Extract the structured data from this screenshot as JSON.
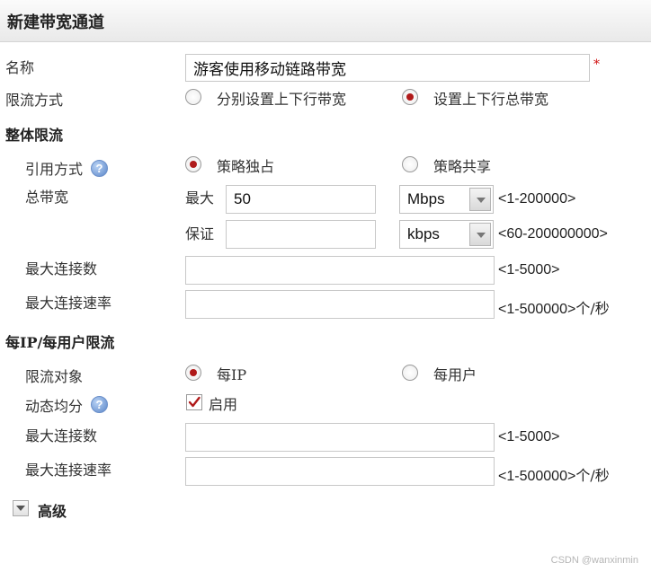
{
  "dialog": {
    "title": "新建带宽通道"
  },
  "name_field": {
    "label": "名称",
    "value": "游客使用移动链路带宽",
    "required_mark": "*"
  },
  "limit_mode": {
    "label": "限流方式",
    "options": [
      {
        "label": "分别设置上下行带宽",
        "selected": false
      },
      {
        "label": "设置上下行总带宽",
        "selected": true
      }
    ]
  },
  "overall": {
    "section_title": "整体限流",
    "reference": {
      "label": "引用方式",
      "options": [
        {
          "label": "策略独占",
          "selected": true
        },
        {
          "label": "策略共享",
          "selected": false
        }
      ]
    },
    "total_bandwidth": {
      "label": "总带宽",
      "max": {
        "label": "最大",
        "value": "50",
        "unit": "Mbps",
        "range": "<1-200000>"
      },
      "guarantee": {
        "label": "保证",
        "value": "",
        "unit": "kbps",
        "range": "<60-200000000>"
      }
    },
    "max_connections": {
      "label": "最大连接数",
      "value": "",
      "range": "<1-5000>"
    },
    "max_conn_rate": {
      "label": "最大连接速率",
      "value": "",
      "range": "<1-500000>",
      "unit": "个/秒"
    }
  },
  "per_ip": {
    "section_title": "每IP/每用户限流",
    "target": {
      "label": "限流对象",
      "options": [
        {
          "label": "每IP",
          "selected": true
        },
        {
          "label": "每用户",
          "selected": false
        }
      ]
    },
    "dynamic_share": {
      "label": "动态均分",
      "checkbox_label": "启用",
      "checked": true
    },
    "max_connections": {
      "label": "最大连接数",
      "value": "",
      "range": "<1-5000>"
    },
    "max_conn_rate": {
      "label": "最大连接速率",
      "value": "",
      "range": "<1-500000>",
      "unit": "个/秒"
    }
  },
  "advanced": {
    "label": "高级"
  },
  "help_icon": "?",
  "watermark": "CSDN @wanxinmin",
  "colors": {
    "radio_selected": "#b01a1a",
    "required": "#d01010",
    "help_icon": "#5b86c8"
  }
}
